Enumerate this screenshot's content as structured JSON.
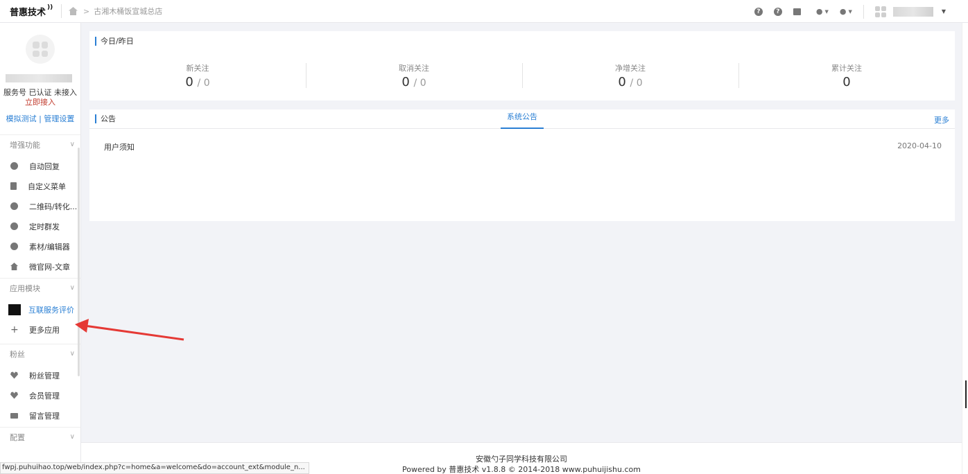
{
  "header": {
    "logo_text": "普惠技术",
    "breadcrumb_store": "古湘木桶饭宣城总店"
  },
  "sidebar": {
    "account_status_prefix": "服务号 已认证 未接入 ",
    "account_status_link": "立即接入",
    "links": {
      "test": "模拟测试",
      "sep": " | ",
      "manage": "管理设置"
    },
    "sections": {
      "enhance": {
        "title": "增强功能",
        "items": [
          {
            "label": "自动回复",
            "icon": "chat-bubble-icon"
          },
          {
            "label": "自定义菜单",
            "icon": "document-icon"
          },
          {
            "label": "二维码/转化...",
            "icon": "qrcode-icon"
          },
          {
            "label": "定时群发",
            "icon": "clock-icon"
          },
          {
            "label": "素材/编辑器",
            "icon": "compass-icon"
          },
          {
            "label": "微官网-文章",
            "icon": "house-icon"
          }
        ]
      },
      "apps": {
        "title": "应用模块",
        "items": [
          {
            "label": "互联服务评价",
            "icon": "app-thumbnail"
          },
          {
            "label": "更多应用",
            "icon": "plus-icon"
          }
        ]
      },
      "fans": {
        "title": "粉丝",
        "items": [
          {
            "label": "粉丝管理",
            "icon": "heart-icon"
          },
          {
            "label": "会员管理",
            "icon": "heart-icon"
          },
          {
            "label": "留言管理",
            "icon": "mail-icon"
          }
        ]
      },
      "config": {
        "title": "配置"
      }
    }
  },
  "main": {
    "stats_panel": {
      "title": "今日/昨日",
      "stats": [
        {
          "label": "新关注",
          "today": "0",
          "yesterday": "/ 0"
        },
        {
          "label": "取消关注",
          "today": "0",
          "yesterday": "/ 0"
        },
        {
          "label": "净增关注",
          "today": "0",
          "yesterday": "/ 0"
        },
        {
          "label": "累计关注",
          "today": "0",
          "yesterday": ""
        }
      ]
    },
    "notice_panel": {
      "title": "公告",
      "tab": "系统公告",
      "more": "更多",
      "notices": [
        {
          "title": "用户须知",
          "date": "2020-04-10"
        }
      ]
    }
  },
  "footer": {
    "company": "安徽勺子同学科技有限公司",
    "powered": "Powered by 普惠技术 v1.8.8 © 2014-2018 www.puhuijishu.com"
  },
  "statusbar": {
    "url": "fwpj.puhuihao.top/web/index.php?c=home&a=welcome&do=account_ext&module_n..."
  },
  "colors": {
    "accent": "#2a7fd4",
    "annotation_arrow": "#e53935",
    "background": "#f2f3f7"
  }
}
